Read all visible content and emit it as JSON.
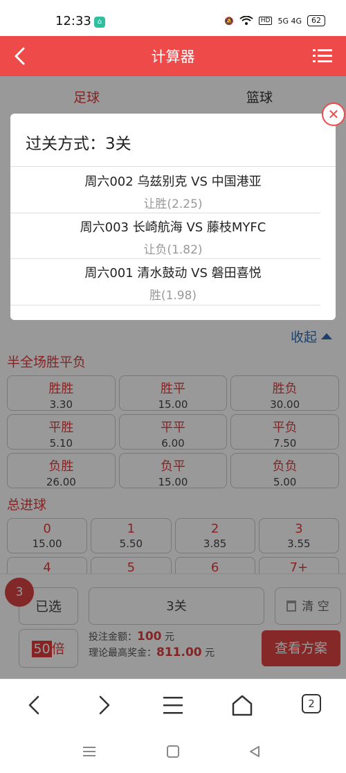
{
  "status_bar": {
    "time": "12:33",
    "network": "5G 4G",
    "battery": "62"
  },
  "header": {
    "title": "计算器"
  },
  "sport_tabs": [
    {
      "label": "足球",
      "active": true
    },
    {
      "label": "篮球",
      "active": false
    }
  ],
  "popup": {
    "title": "过关方式：3关",
    "matches": [
      {
        "title": "周六002   乌兹别克 VS 中国港亚",
        "pick": "让胜(2.25)"
      },
      {
        "title": "周六003   长崎航海 VS 藤枝MYFC",
        "pick": "让负(1.82)"
      },
      {
        "title": "周六001   清水鼓动 VS 磐田喜悦",
        "pick": "胜(1.98)"
      }
    ]
  },
  "collapse_label": "收起",
  "half_full": {
    "title": "半全场胜平负",
    "cells": [
      {
        "name": "胜胜",
        "odds": "3.30"
      },
      {
        "name": "胜平",
        "odds": "15.00"
      },
      {
        "name": "胜负",
        "odds": "30.00"
      },
      {
        "name": "平胜",
        "odds": "5.10"
      },
      {
        "name": "平平",
        "odds": "6.00"
      },
      {
        "name": "平负",
        "odds": "7.50"
      },
      {
        "name": "负胜",
        "odds": "26.00"
      },
      {
        "name": "负平",
        "odds": "15.00"
      },
      {
        "name": "负负",
        "odds": "5.00"
      }
    ]
  },
  "total_goals": {
    "title": "总进球",
    "cells": [
      {
        "name": "0",
        "odds": "15.00"
      },
      {
        "name": "1",
        "odds": "5.50"
      },
      {
        "name": "2",
        "odds": "3.85"
      },
      {
        "name": "3",
        "odds": "3.55"
      },
      {
        "name": "4",
        "odds": ""
      },
      {
        "name": "5",
        "odds": ""
      },
      {
        "name": "6",
        "odds": ""
      },
      {
        "name": "7+",
        "odds": ""
      }
    ]
  },
  "bottom": {
    "badge_count": "3",
    "selected_label": "已选",
    "pass_label": "3关",
    "clear_label": "清 空",
    "multiplier_num": "50",
    "multiplier_unit": "倍",
    "bet_label": "投注金额：",
    "bet_amount": "100",
    "bet_unit": "元",
    "max_label": "理论最高奖金：",
    "max_amount": "811.00",
    "max_unit": "元",
    "view_label": "查看方案"
  },
  "browser_nav": {
    "tabs_count": "2"
  },
  "colors": {
    "brand_red": "#ef4a4a",
    "link_blue": "#2f6fb5"
  }
}
